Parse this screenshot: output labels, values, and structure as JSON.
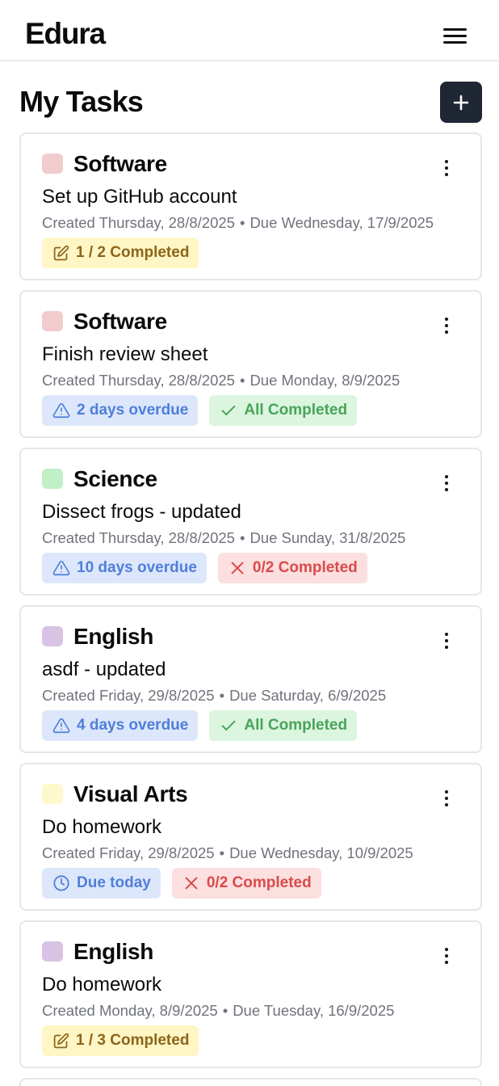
{
  "app": {
    "logo": "Edura"
  },
  "page": {
    "title": "My Tasks"
  },
  "colors": {
    "software": "#f2cccd",
    "science": "#c1efc6",
    "english": "#d8c3e4",
    "visual_arts": "#fef8cc",
    "primary_button": "#1f2634"
  },
  "tasks": [
    {
      "subject": "Software",
      "swatch_color": "#f2cccd",
      "name": "Set up GitHub account",
      "created": "Created Thursday, 28/8/2025",
      "sep": "•",
      "due": "Due Wednesday, 17/9/2025",
      "badges": [
        {
          "icon": "pencil-icon",
          "label": "1 / 2 Completed",
          "tone": "yellow"
        }
      ]
    },
    {
      "subject": "Software",
      "swatch_color": "#f2cccd",
      "name": "Finish review sheet",
      "created": "Created Thursday, 28/8/2025",
      "sep": "•",
      "due": "Due Monday, 8/9/2025",
      "badges": [
        {
          "icon": "warning-icon",
          "label": "2 days overdue",
          "tone": "blue"
        },
        {
          "icon": "check-icon",
          "label": "All Completed",
          "tone": "green"
        }
      ]
    },
    {
      "subject": "Science",
      "swatch_color": "#c1efc6",
      "name": "Dissect frogs - updated",
      "created": "Created Thursday, 28/8/2025",
      "sep": "•",
      "due": "Due Sunday, 31/8/2025",
      "badges": [
        {
          "icon": "warning-icon",
          "label": "10 days overdue",
          "tone": "blue"
        },
        {
          "icon": "x-icon",
          "label": "0/2 Completed",
          "tone": "red"
        }
      ]
    },
    {
      "subject": "English",
      "swatch_color": "#d8c3e4",
      "name": "asdf - updated",
      "created": "Created Friday, 29/8/2025",
      "sep": "•",
      "due": "Due Saturday, 6/9/2025",
      "badges": [
        {
          "icon": "warning-icon",
          "label": "4 days overdue",
          "tone": "blue"
        },
        {
          "icon": "check-icon",
          "label": "All Completed",
          "tone": "green"
        }
      ]
    },
    {
      "subject": "Visual Arts",
      "swatch_color": "#fef8cc",
      "name": "Do homework",
      "created": "Created Friday, 29/8/2025",
      "sep": "•",
      "due": "Due Wednesday, 10/9/2025",
      "badges": [
        {
          "icon": "clock-icon",
          "label": "Due today",
          "tone": "blue"
        },
        {
          "icon": "x-icon",
          "label": "0/2 Completed",
          "tone": "red"
        }
      ]
    },
    {
      "subject": "English",
      "swatch_color": "#d8c3e4",
      "name": "Do homework",
      "created": "Created Monday, 8/9/2025",
      "sep": "•",
      "due": "Due Tuesday, 16/9/2025",
      "badges": [
        {
          "icon": "pencil-icon",
          "label": "1 / 3 Completed",
          "tone": "yellow"
        }
      ]
    }
  ]
}
